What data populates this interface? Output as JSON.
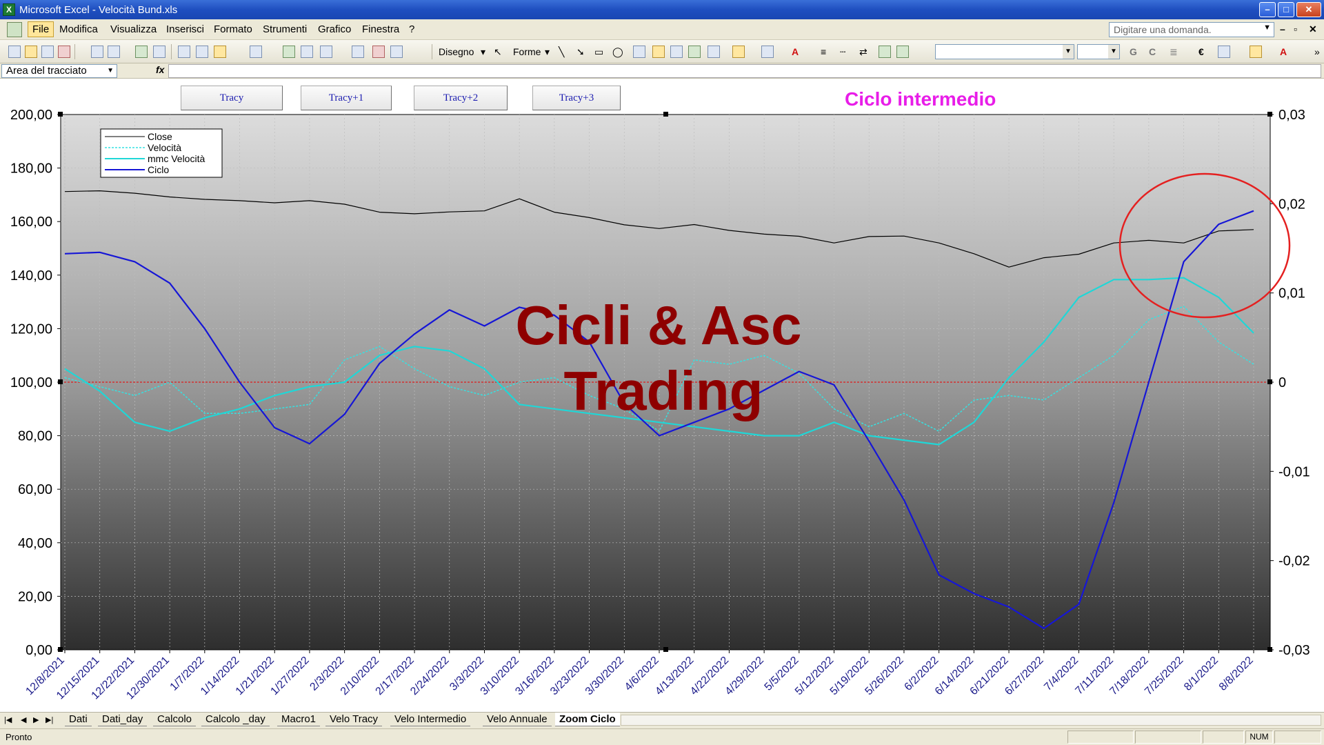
{
  "window": {
    "title": "Microsoft Excel - Velocità Bund.xls"
  },
  "menu": {
    "items": [
      "File",
      "Modifica",
      "Visualizza",
      "Inserisci",
      "Formato",
      "Strumenti",
      "Grafico",
      "Finestra",
      "?"
    ],
    "ask_placeholder": "Digitare una domanda."
  },
  "toolbar": {
    "disegno": "Disegno",
    "forme": "Forme"
  },
  "namebox": {
    "value": "Area del tracciato",
    "fx": "fx"
  },
  "macros": [
    "Tracy",
    "Tracy+1",
    "Tracy+2",
    "Tracy+3"
  ],
  "chart_title": "Ciclo intermedio",
  "watermark": [
    "Cicli & Asc",
    "Trading"
  ],
  "chart_data": {
    "type": "line",
    "legend": [
      "Close",
      "Velocità",
      "mmc Velocità",
      "Ciclo"
    ],
    "legend_position": "top-left",
    "y_left": {
      "ticks": [
        "0,00",
        "20,00",
        "40,00",
        "60,00",
        "80,00",
        "100,00",
        "120,00",
        "140,00",
        "160,00",
        "180,00",
        "200,00"
      ],
      "min": 0,
      "max": 200
    },
    "y_right": {
      "ticks": [
        "-0,03",
        "-0,02",
        "-0,01",
        "0",
        "0,01",
        "0,02",
        "0,03"
      ],
      "min": -0.03,
      "max": 0.03
    },
    "x_ticks": [
      "12/8/2021",
      "12/15/2021",
      "12/22/2021",
      "12/30/2021",
      "1/7/2022",
      "1/14/2022",
      "1/21/2022",
      "1/27/2022",
      "2/3/2022",
      "2/10/2022",
      "2/17/2022",
      "2/24/2022",
      "3/3/2022",
      "3/10/2022",
      "3/16/2022",
      "3/23/2022",
      "3/30/2022",
      "4/6/2022",
      "4/13/2022",
      "4/22/2022",
      "4/29/2022",
      "5/5/2022",
      "5/12/2022",
      "5/19/2022",
      "5/26/2022",
      "6/2/2022",
      "6/14/2022",
      "6/21/2022",
      "6/27/2022",
      "7/4/2022",
      "7/11/2022",
      "7/18/2022",
      "7/25/2022",
      "8/1/2022",
      "8/8/2022"
    ],
    "series": [
      {
        "name": "Close",
        "color": "#000000",
        "axis": "left",
        "values": [
          171.2,
          171.5,
          170.6,
          169.2,
          168.3,
          167.8,
          167.0,
          167.8,
          166.5,
          163.5,
          162.9,
          163.6,
          164.0,
          168.5,
          163.5,
          161.5,
          158.8,
          157.4,
          158.9,
          156.7,
          155.3,
          154.5,
          152.0,
          154.4,
          154.6,
          152.0,
          148.0,
          143.0,
          146.5,
          147.8,
          152.0,
          153.0,
          152.0,
          156.5,
          157.0
        ]
      },
      {
        "name": "Velocità",
        "color": "#35e2e2",
        "axis": "right",
        "dashed": true,
        "values": [
          0.0005,
          -0.0005,
          -0.0015,
          0.0,
          -0.0035,
          -0.0035,
          -0.003,
          -0.0025,
          0.0025,
          0.004,
          0.0015,
          -0.0005,
          -0.0015,
          0.0,
          0.0005,
          -0.0015,
          -0.003,
          -0.0055,
          0.0025,
          0.002,
          0.003,
          0.001,
          -0.003,
          -0.005,
          -0.0035,
          -0.0055,
          -0.002,
          -0.0015,
          -0.002,
          0.0005,
          0.003,
          0.007,
          0.0085,
          0.0045,
          0.002
        ]
      },
      {
        "name": "mmc Velocità",
        "color": "#1fd7d7",
        "axis": "right",
        "values": [
          0.0015,
          -0.001,
          -0.0045,
          -0.0055,
          -0.004,
          -0.003,
          -0.0015,
          -0.0005,
          0.0,
          0.003,
          0.004,
          0.0035,
          0.0015,
          -0.0025,
          -0.003,
          -0.0035,
          -0.004,
          -0.0045,
          -0.005,
          -0.0055,
          -0.006,
          -0.006,
          -0.0045,
          -0.006,
          -0.0065,
          -0.007,
          -0.0045,
          0.0005,
          0.0045,
          0.0095,
          0.0115,
          0.0115,
          0.0117,
          0.0095,
          0.0055
        ]
      },
      {
        "name": "Ciclo",
        "color": "#1616d6",
        "axis": "left",
        "values": [
          148.0,
          148.5,
          145.0,
          137.0,
          120.0,
          100.0,
          83.0,
          77.0,
          88.0,
          107.0,
          118.0,
          127.0,
          121.0,
          128.0,
          125.0,
          115.0,
          92.0,
          80.0,
          85.0,
          90.0,
          97.0,
          104.0,
          99.0,
          78.0,
          56.0,
          28.0,
          21.0,
          16.0,
          8.0,
          17.0,
          55.0,
          100.0,
          145.0,
          159.0,
          164.0
        ]
      }
    ]
  }
}
